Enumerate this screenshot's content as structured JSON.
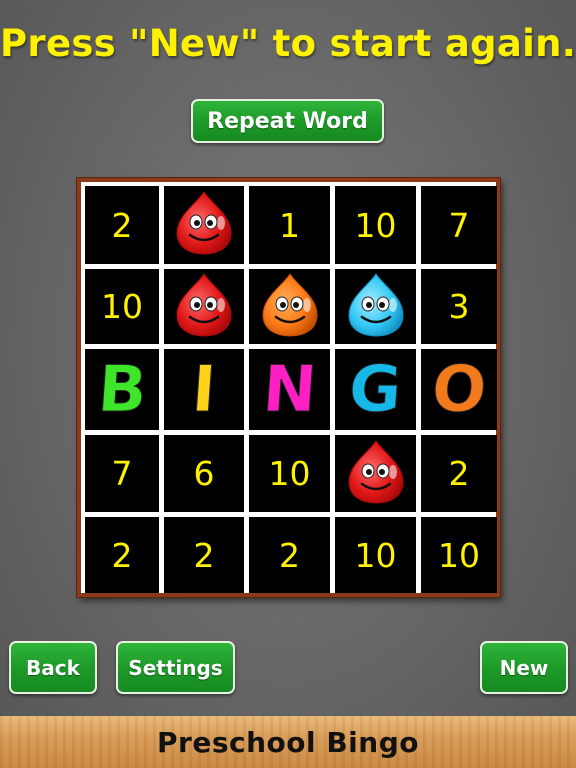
{
  "headline": "Press \"New\" to start again.",
  "buttons": {
    "repeat": "Repeat Word",
    "back": "Back",
    "settings": "Settings",
    "new": "New"
  },
  "footer_title": "Preschool Bingo",
  "board": {
    "rows": [
      [
        {
          "t": "num",
          "v": "2"
        },
        {
          "t": "drop",
          "color": "red"
        },
        {
          "t": "num",
          "v": "1"
        },
        {
          "t": "num",
          "v": "10"
        },
        {
          "t": "num",
          "v": "7"
        }
      ],
      [
        {
          "t": "num",
          "v": "10"
        },
        {
          "t": "drop",
          "color": "red"
        },
        {
          "t": "drop",
          "color": "orange"
        },
        {
          "t": "drop",
          "color": "blue"
        },
        {
          "t": "num",
          "v": "3"
        }
      ],
      [
        {
          "t": "letter",
          "v": "B",
          "color": "#3ee62a"
        },
        {
          "t": "letter",
          "v": "I",
          "color": "#ffd21a"
        },
        {
          "t": "letter",
          "v": "N",
          "color": "#ff1fc4"
        },
        {
          "t": "letter",
          "v": "G",
          "color": "#16b8e8"
        },
        {
          "t": "letter",
          "v": "O",
          "color": "#f27a1a"
        }
      ],
      [
        {
          "t": "num",
          "v": "7"
        },
        {
          "t": "num",
          "v": "6"
        },
        {
          "t": "num",
          "v": "10"
        },
        {
          "t": "drop",
          "color": "red"
        },
        {
          "t": "num",
          "v": "2"
        }
      ],
      [
        {
          "t": "num",
          "v": "2"
        },
        {
          "t": "num",
          "v": "2"
        },
        {
          "t": "num",
          "v": "2"
        },
        {
          "t": "num",
          "v": "10"
        },
        {
          "t": "num",
          "v": "10"
        }
      ]
    ]
  },
  "colors": {
    "headline": "#fff200",
    "button_green": "#1e9a29",
    "board_frame": "#8a3a1a",
    "drop_red": "#ef1f1f",
    "drop_orange": "#ff7a16",
    "drop_blue": "#35c9f5"
  }
}
